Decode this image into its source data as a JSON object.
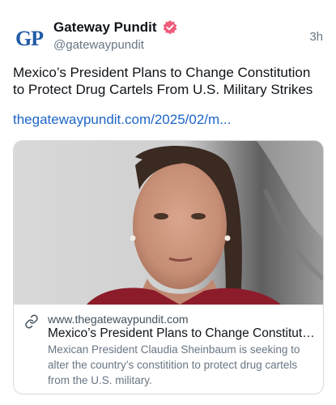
{
  "author": {
    "avatar_text": "GP",
    "display_name": "Gateway Pundit",
    "handle": "@gatewaypundit",
    "verified_icon": "verified-badge-icon",
    "verified_color": "#ef5b7a"
  },
  "post": {
    "time": "3h",
    "text": "Mexico’s President Plans to Change Constitution to Protect Drug Cartels From U.S. Military Strikes",
    "link": "thegatewaypundit.com/2025/02/m..."
  },
  "card": {
    "link_icon": "link-icon",
    "domain": "www.thegatewaypundit.com",
    "title": "Mexico’s President Plans to Change Constituti...",
    "description": "Mexican President Claudia Sheinbaum is seeking to alter the country’s constitition to protect drug cartels from the U.S. military."
  },
  "colors": {
    "link": "#1d65c8",
    "secondary_text": "#687684",
    "brand_blue": "#1f5aa6"
  }
}
